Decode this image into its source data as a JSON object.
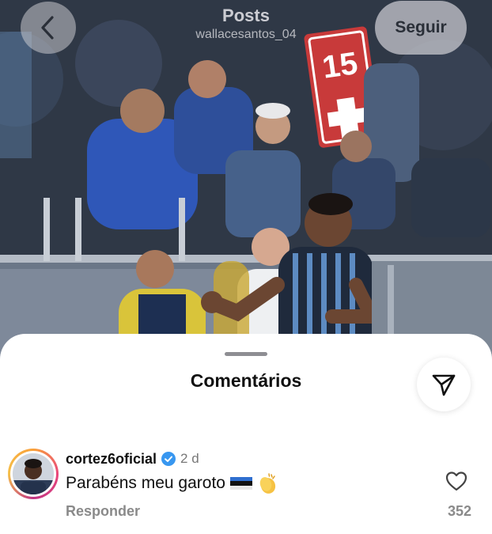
{
  "header": {
    "title": "Posts",
    "username": "wallacesantos_04",
    "follow_label": "Seguir"
  },
  "photo": {
    "jersey_number": "15"
  },
  "sheet": {
    "title": "Comentários"
  },
  "comment": {
    "username": "cortez6oficial",
    "time": "2 d",
    "text": "Parabéns meu garoto",
    "reply_label": "Responder",
    "likes": "352",
    "emojis": [
      "flag-icon",
      "clapping-hands-icon"
    ]
  },
  "colors": {
    "verified": "#3897f0",
    "title": "#111111",
    "muted": "#8a8a8a"
  }
}
